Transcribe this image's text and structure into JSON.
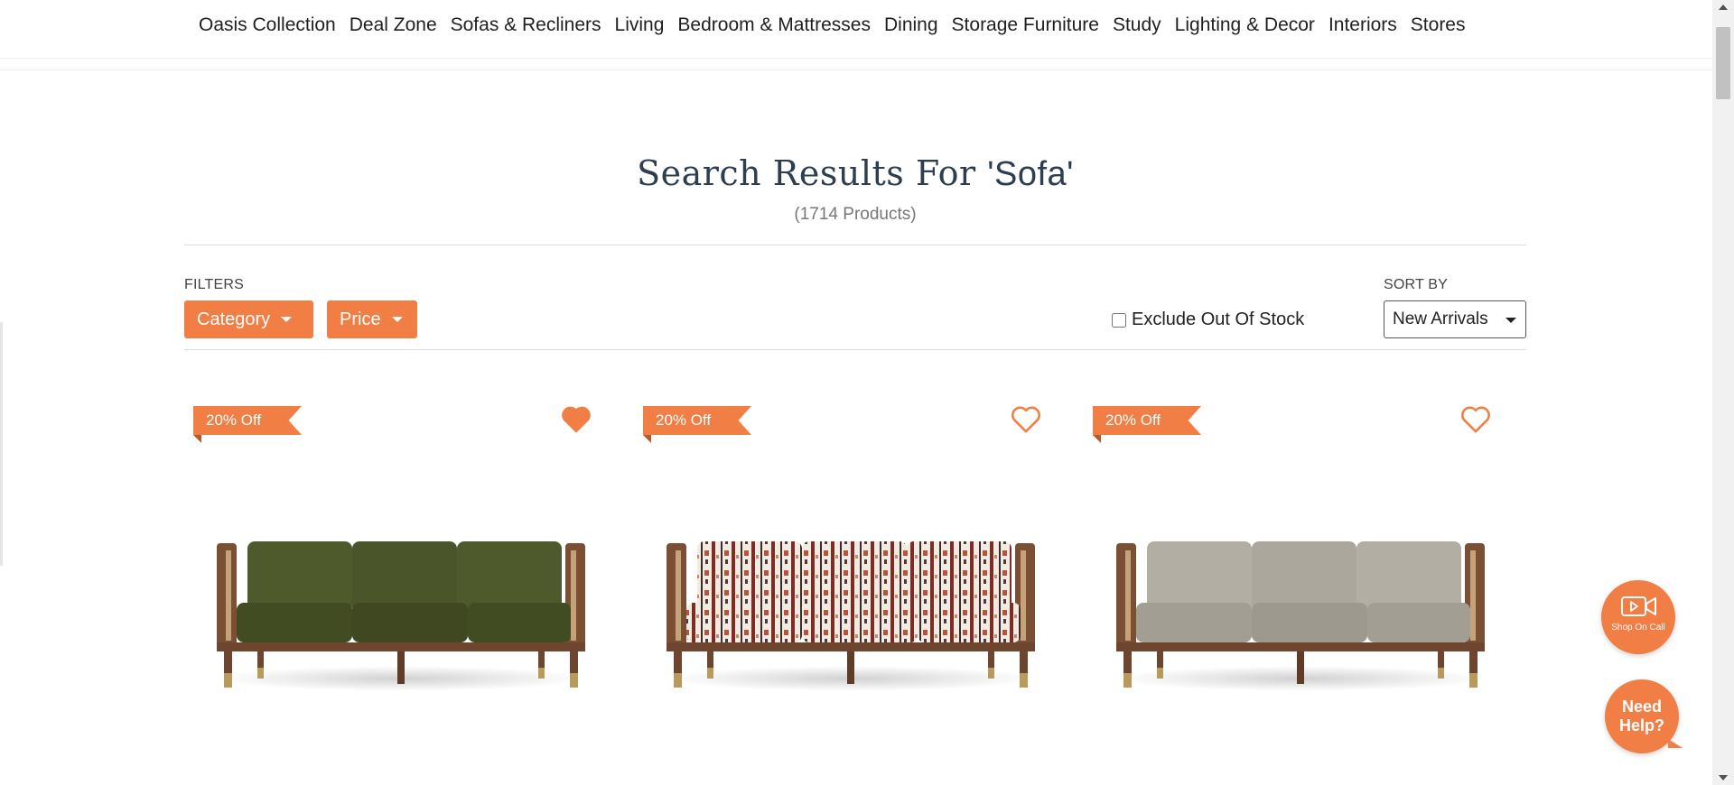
{
  "nav": {
    "items": [
      "Oasis Collection",
      "Deal Zone",
      "Sofas & Recliners",
      "Living",
      "Bedroom & Mattresses",
      "Dining",
      "Storage Furniture",
      "Study",
      "Lighting & Decor",
      "Interiors",
      "Stores"
    ]
  },
  "search": {
    "title_prefix": "Search Results For ",
    "query": "'Sofa'",
    "count": "(1714 Products)"
  },
  "filters": {
    "label": "FILTERS",
    "buttons": [
      "Category",
      "Price"
    ],
    "exclude_label": "Exclude Out Of Stock",
    "exclude_checked": false
  },
  "sort": {
    "label": "SORT BY",
    "selected": "New Arrivals"
  },
  "products": [
    {
      "badge": "20% Off",
      "wishlisted": true,
      "fabric": "green-velvet"
    },
    {
      "badge": "20% Off",
      "wishlisted": false,
      "fabric": "ikat-pattern"
    },
    {
      "badge": "20% Off",
      "wishlisted": false,
      "fabric": "grey-linen"
    }
  ],
  "widgets": {
    "shop_on_call": "Shop On Call",
    "need_help_line1": "Need",
    "need_help_line2": "Help?"
  },
  "colors": {
    "accent": "#f07e45",
    "heading": "#2c3e50"
  }
}
